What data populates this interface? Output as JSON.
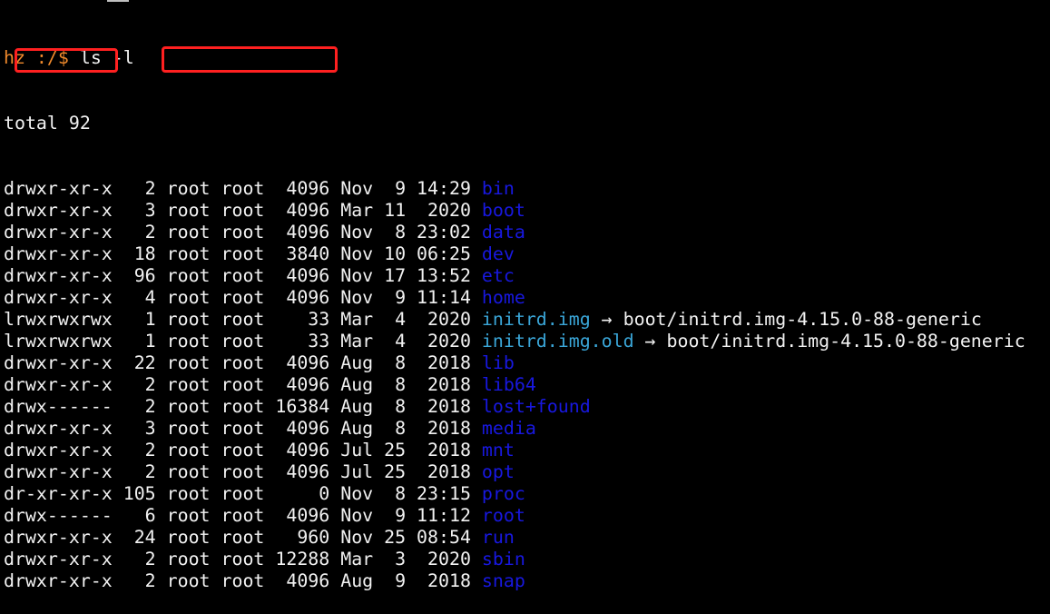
{
  "prompt": {
    "user": "hz",
    "path": " :/$ ",
    "command": "ls -l",
    "color": "#f08a2c"
  },
  "total_line": "total 92",
  "colors": {
    "text": "#f2f2f2",
    "directory": "#1818e0",
    "symlink": "#3aa6d8",
    "highlight": "#ff2020"
  },
  "entries": [
    {
      "meta": "drwxr-xr-x   2 root root  4096 Nov  9 14:29 ",
      "name": "bin",
      "kind": "dir",
      "target": ""
    },
    {
      "meta": "drwxr-xr-x   3 root root  4096 Mar 11  2020 ",
      "name": "boot",
      "kind": "dir",
      "target": ""
    },
    {
      "meta": "drwxr-xr-x   2 root root  4096 Nov  8 23:02 ",
      "name": "data",
      "kind": "dir",
      "target": ""
    },
    {
      "meta": "drwxr-xr-x  18 root root  3840 Nov 10 06:25 ",
      "name": "dev",
      "kind": "dir",
      "target": ""
    },
    {
      "meta": "drwxr-xr-x  96 root root  4096 Nov 17 13:52 ",
      "name": "etc",
      "kind": "dir",
      "target": ""
    },
    {
      "meta": "drwxr-xr-x   4 root root  4096 Nov  9 11:14 ",
      "name": "home",
      "kind": "dir",
      "target": ""
    },
    {
      "meta": "lrwxrwxrwx   1 root root    33 Mar  4  2020 ",
      "name": "initrd.img",
      "kind": "link",
      "target": " → boot/initrd.img-4.15.0-88-generic"
    },
    {
      "meta": "lrwxrwxrwx   1 root root    33 Mar  4  2020 ",
      "name": "initrd.img.old",
      "kind": "link",
      "target": " → boot/initrd.img-4.15.0-88-generic"
    },
    {
      "meta": "drwxr-xr-x  22 root root  4096 Aug  8  2018 ",
      "name": "lib",
      "kind": "dir",
      "target": ""
    },
    {
      "meta": "drwxr-xr-x   2 root root  4096 Aug  8  2018 ",
      "name": "lib64",
      "kind": "dir",
      "target": ""
    },
    {
      "meta": "drwx------   2 root root 16384 Aug  8  2018 ",
      "name": "lost+found",
      "kind": "dir",
      "target": ""
    },
    {
      "meta": "drwxr-xr-x   3 root root  4096 Aug  8  2018 ",
      "name": "media",
      "kind": "dir",
      "target": ""
    },
    {
      "meta": "drwxr-xr-x   2 root root  4096 Jul 25  2018 ",
      "name": "mnt",
      "kind": "dir",
      "target": ""
    },
    {
      "meta": "drwxr-xr-x   2 root root  4096 Jul 25  2018 ",
      "name": "opt",
      "kind": "dir",
      "target": ""
    },
    {
      "meta": "dr-xr-xr-x 105 root root     0 Nov  8 23:15 ",
      "name": "proc",
      "kind": "dir",
      "target": ""
    },
    {
      "meta": "drwx------   6 root root  4096 Nov  9 11:12 ",
      "name": "root",
      "kind": "dir",
      "target": ""
    },
    {
      "meta": "drwxr-xr-x  24 root root   960 Nov 25 08:54 ",
      "name": "run",
      "kind": "dir",
      "target": ""
    },
    {
      "meta": "drwxr-xr-x   2 root root 12288 Mar  3  2020 ",
      "name": "sbin",
      "kind": "dir",
      "target": ""
    },
    {
      "meta": "drwxr-xr-x   2 root root  4096 Aug  9  2018 ",
      "name": "snap",
      "kind": "dir",
      "target": ""
    }
  ]
}
